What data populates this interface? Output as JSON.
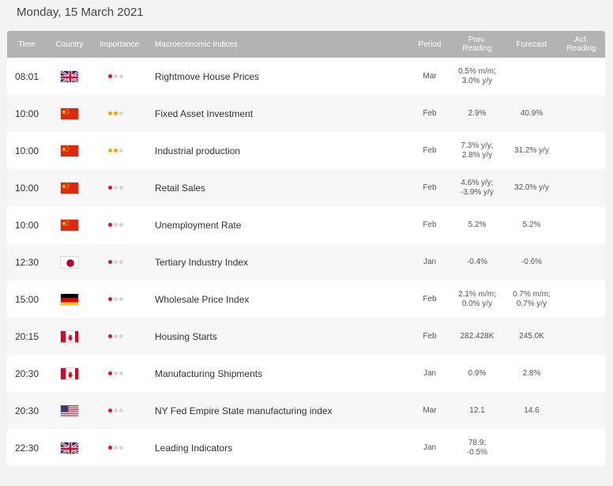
{
  "header": {
    "date": "Monday, 15 March 2021"
  },
  "columns": {
    "time": "Time",
    "country": "Country",
    "importance": "Importance",
    "indices": "Macroeconomic Indices",
    "period": "Period",
    "prev_line1": "Prev.",
    "prev_line2": "Reading",
    "forecast": "Forecast",
    "act_line1": "Act.",
    "act_line2": "Reading"
  },
  "importance_colors": {
    "high": "#e8112d",
    "medium": "#f5a800",
    "off": "#d6d6d6"
  },
  "rows": [
    {
      "time": "08:01",
      "flag": "uk-flag-icon",
      "importance": 1,
      "importance_color": "#e8112d",
      "name": "Rightmove House Prices",
      "period": "Mar",
      "prev1": "0.5% m/m;",
      "prev2": "3.0% y/y",
      "fc1": "",
      "fc2": "",
      "act": ""
    },
    {
      "time": "10:00",
      "flag": "china-flag-icon",
      "importance": 2,
      "importance_color": "#f5a800",
      "name": "Fixed Asset Investment",
      "period": "Feb",
      "prev1": "2.9%",
      "prev2": "",
      "fc1": "40.9%",
      "fc2": "",
      "act": ""
    },
    {
      "time": "10:00",
      "flag": "china-flag-icon",
      "importance": 2,
      "importance_color": "#f5a800",
      "name": "Industrial production",
      "period": "Feb",
      "prev1": "7.3% y/y;",
      "prev2": "2.8% y/y",
      "fc1": "31.2% y/y",
      "fc2": "",
      "act": ""
    },
    {
      "time": "10:00",
      "flag": "china-flag-icon",
      "importance": 1,
      "importance_color": "#e8112d",
      "name": "Retail Sales",
      "period": "Feb",
      "prev1": "4.6% y/y;",
      "prev2": "-3.9% y/y",
      "fc1": "32.0% y/y",
      "fc2": "",
      "act": ""
    },
    {
      "time": "10:00",
      "flag": "china-flag-icon",
      "importance": 1,
      "importance_color": "#e8112d",
      "name": "Unemployment Rate",
      "period": "Feb",
      "prev1": "5.2%",
      "prev2": "",
      "fc1": "5.2%",
      "fc2": "",
      "act": ""
    },
    {
      "time": "12:30",
      "flag": "japan-flag-icon",
      "importance": 1,
      "importance_color": "#e8112d",
      "name": "Tertiary Industry Index",
      "period": "Jan",
      "prev1": "-0.4%",
      "prev2": "",
      "fc1": "-0.6%",
      "fc2": "",
      "act": ""
    },
    {
      "time": "15:00",
      "flag": "germany-flag-icon",
      "importance": 1,
      "importance_color": "#e8112d",
      "name": "Wholesale Price Index",
      "period": "Feb",
      "prev1": "2.1% m/m;",
      "prev2": "0.0% y/y",
      "fc1": "0.7% m/m;",
      "fc2": "0.7% y/y",
      "act": ""
    },
    {
      "time": "20:15",
      "flag": "canada-flag-icon",
      "importance": 1,
      "importance_color": "#e8112d",
      "name": "Housing Starts",
      "period": "Feb",
      "prev1": "282.428K",
      "prev2": "",
      "fc1": "245.0K",
      "fc2": "",
      "act": ""
    },
    {
      "time": "20:30",
      "flag": "canada-flag-icon",
      "importance": 1,
      "importance_color": "#e8112d",
      "name": "Manufacturing Shipments",
      "period": "Jan",
      "prev1": "0.9%",
      "prev2": "",
      "fc1": "2.8%",
      "fc2": "",
      "act": ""
    },
    {
      "time": "20:30",
      "flag": "usa-flag-icon",
      "importance": 1,
      "importance_color": "#e8112d",
      "name": "NY Fed Empire State manufacturing index",
      "period": "Mar",
      "prev1": "12.1",
      "prev2": "",
      "fc1": "14.6",
      "fc2": "",
      "act": ""
    },
    {
      "time": "22:30",
      "flag": "uk-flag-icon",
      "importance": 1,
      "importance_color": "#e8112d",
      "name": "Leading Indicators",
      "period": "Jan",
      "prev1": "78.9;",
      "prev2": "-0.5%",
      "fc1": "",
      "fc2": "",
      "act": ""
    }
  ]
}
